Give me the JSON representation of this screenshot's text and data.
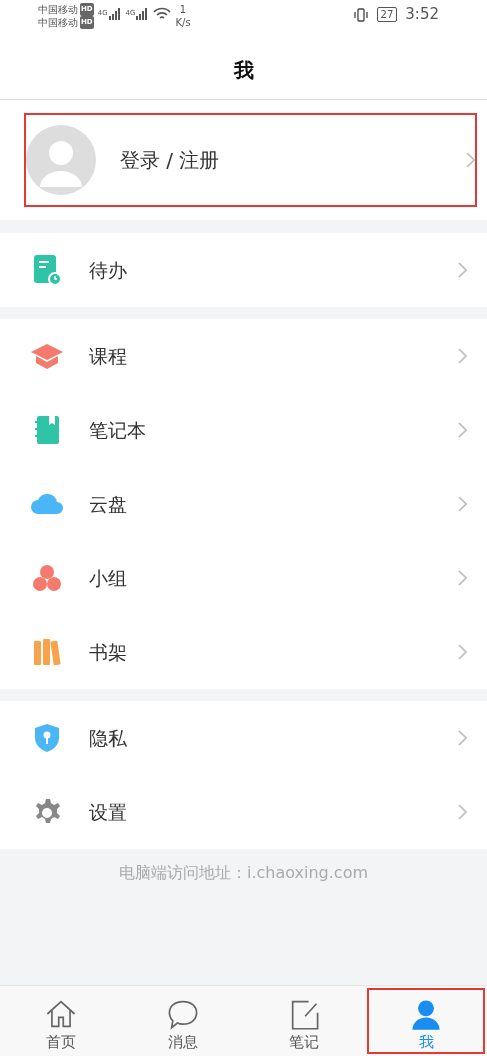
{
  "status_bar": {
    "carriers": [
      {
        "name": "中国移动",
        "badge": "HD"
      },
      {
        "name": "中国移动",
        "badge": "HD"
      }
    ],
    "networks": [
      "4G",
      "4G"
    ],
    "speed_value": "1",
    "speed_unit": "K/s",
    "battery": "27",
    "time": "3:52"
  },
  "header": {
    "title": "我"
  },
  "profile": {
    "label": "登录 / 注册",
    "highlighted": true
  },
  "menu_groups": [
    {
      "items": [
        {
          "label": "待办"
        }
      ]
    },
    {
      "items": [
        {
          "label": "课程"
        },
        {
          "label": "笔记本"
        },
        {
          "label": "云盘"
        },
        {
          "label": "小组"
        },
        {
          "label": "书架"
        }
      ]
    },
    {
      "items": [
        {
          "label": "隐私"
        },
        {
          "label": "设置"
        }
      ]
    }
  ],
  "footer_note": "电脑端访问地址：i.chaoxing.com",
  "tabs": [
    {
      "label": "首页",
      "selected": false,
      "highlighted": false
    },
    {
      "label": "消息",
      "selected": false,
      "highlighted": false
    },
    {
      "label": "笔记",
      "selected": false,
      "highlighted": false
    },
    {
      "label": "我",
      "selected": true,
      "highlighted": true
    }
  ]
}
